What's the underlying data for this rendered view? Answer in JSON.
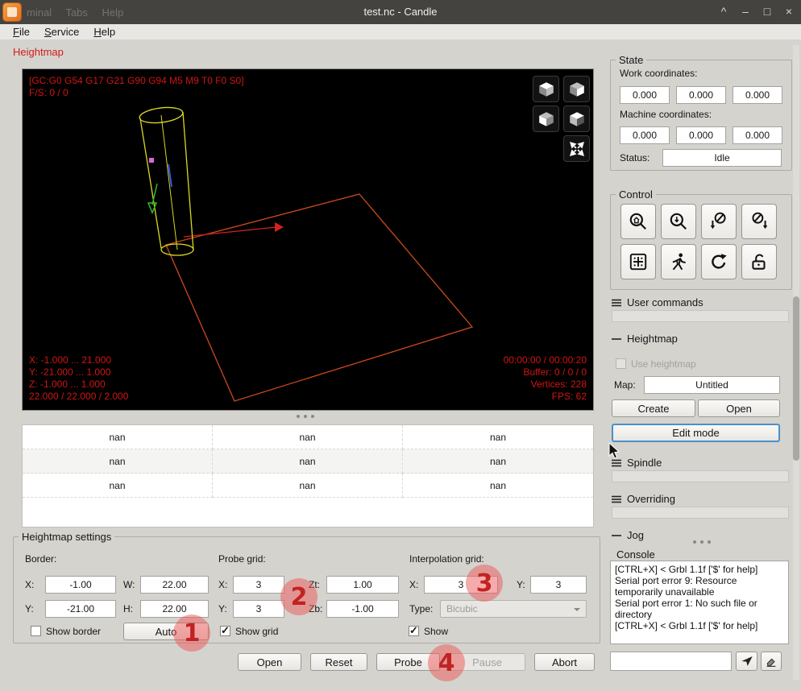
{
  "window": {
    "title": "test.nc - Candle",
    "background_text": "minal Tabs Help",
    "controls": {
      "shade": "^",
      "minimize": "–",
      "maximize": "□",
      "close": "×"
    }
  },
  "menubar": {
    "items": [
      "File",
      "Service",
      "Help"
    ]
  },
  "tab": {
    "label": "Heightmap"
  },
  "viewport": {
    "gc_line": "[GC:G0 G54 G17 G21 G90 G94 M5 M9 T0 F0 S0]",
    "fs_line": "F/S: 0 / 0",
    "range_x": "X: -1.000 ... 21.000",
    "range_y": "Y: -21.000 ... 1.000",
    "range_z": "Z: -1.000 ... 1.000",
    "dimensions": "22.000 / 22.000 / 2.000",
    "time": "00:00:00 / 00:00:20",
    "buffer": "Buffer: 0 / 0 / 0",
    "vertices": "Vertices: 228",
    "fps": "FPS: 62"
  },
  "grid_table": {
    "rows": [
      [
        "nan",
        "nan",
        "nan"
      ],
      [
        "nan",
        "nan",
        "nan"
      ],
      [
        "nan",
        "nan",
        "nan"
      ]
    ]
  },
  "settings": {
    "title": "Heightmap settings",
    "border": {
      "label": "Border:",
      "x_label": "X:",
      "x_value": "-1.00",
      "w_label": "W:",
      "w_value": "22.00",
      "y_label": "Y:",
      "y_value": "-21.00",
      "h_label": "H:",
      "h_value": "22.00",
      "show_label": "Show border",
      "auto_label": "Auto"
    },
    "probe": {
      "label": "Probe grid:",
      "x_label": "X:",
      "x_value": "3",
      "y_label": "Y:",
      "y_value": "3",
      "zt_label": "Zt:",
      "zt_value": "1.00",
      "zb_label": "Zb:",
      "zb_value": "-1.00",
      "show_label": "Show grid"
    },
    "interpolation": {
      "label": "Interpolation grid:",
      "x_label": "X:",
      "x_value": "3",
      "y_label": "Y:",
      "y_value": "3",
      "type_label": "Type:",
      "type_value": "Bicubic",
      "show_label": "Show"
    },
    "actions": {
      "open": "Open",
      "reset": "Reset",
      "probe": "Probe",
      "pause": "Pause",
      "abort": "Abort"
    }
  },
  "state": {
    "title": "State",
    "work_label": "Work coordinates:",
    "work": [
      "0.000",
      "0.000",
      "0.000"
    ],
    "machine_label": "Machine coordinates:",
    "machine": [
      "0.000",
      "0.000",
      "0.000"
    ],
    "status_label": "Status:",
    "status_value": "Idle"
  },
  "control": {
    "title": "Control"
  },
  "panels": {
    "user_commands": "User commands",
    "heightmap": {
      "title": "Heightmap",
      "use_label": "Use heightmap",
      "map_label": "Map:",
      "map_value": "Untitled",
      "create": "Create",
      "open": "Open",
      "edit_mode": "Edit mode"
    },
    "spindle": "Spindle",
    "overriding": "Overriding",
    "jog": "Jog"
  },
  "console": {
    "title": "Console",
    "lines": [
      "[CTRL+X] < Grbl 1.1f ['$' for help]",
      "Serial port error 9: Resource temporarily unavailable",
      "Serial port error 1: No such file or directory",
      "[CTRL+X] < Grbl 1.1f ['$' for help]"
    ],
    "command_value": ""
  },
  "annotations": {
    "n1": "1",
    "n2": "2",
    "n3": "3",
    "n4": "4"
  },
  "colors": {
    "accent_red": "#d01515",
    "annotation_fill": "#ec5858",
    "focus_blue": "#4a90c8",
    "plane": "#cd4a1a",
    "tool": "#d9d920"
  }
}
